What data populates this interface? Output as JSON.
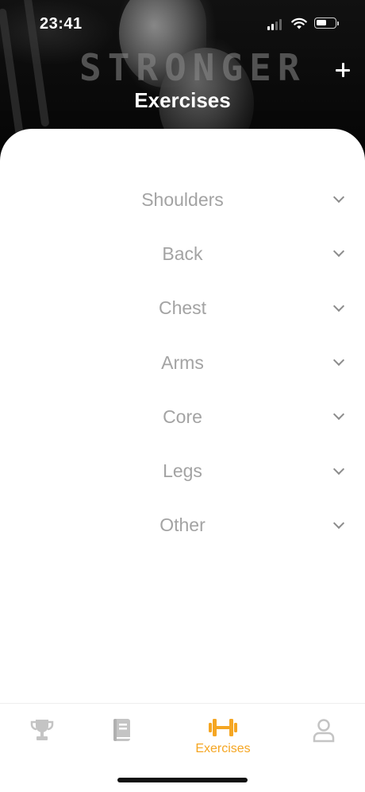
{
  "status_bar": {
    "time": "23:41"
  },
  "header": {
    "logo_text": "STRONGER",
    "title": "Exercises",
    "add_icon": "plus-icon"
  },
  "categories": [
    {
      "label": "Shoulders",
      "icon": "chevron-down-icon"
    },
    {
      "label": "Back",
      "icon": "chevron-down-icon"
    },
    {
      "label": "Chest",
      "icon": "chevron-down-icon"
    },
    {
      "label": "Arms",
      "icon": "chevron-down-icon"
    },
    {
      "label": "Core",
      "icon": "chevron-down-icon"
    },
    {
      "label": "Legs",
      "icon": "chevron-down-icon"
    },
    {
      "label": "Other",
      "icon": "chevron-down-icon"
    }
  ],
  "tab_bar": {
    "tabs": [
      {
        "icon": "trophy-icon",
        "label": "",
        "active": false
      },
      {
        "icon": "book-icon",
        "label": "",
        "active": false
      },
      {
        "icon": "dumbbell-icon",
        "label": "Exercises",
        "active": true
      },
      {
        "icon": "profile-icon",
        "label": "",
        "active": false
      }
    ]
  },
  "colors": {
    "accent": "#f5a623",
    "inactive_icon": "#c4c4c4",
    "category_text": "#a3a3a3",
    "chevron": "#8c8c8c"
  }
}
